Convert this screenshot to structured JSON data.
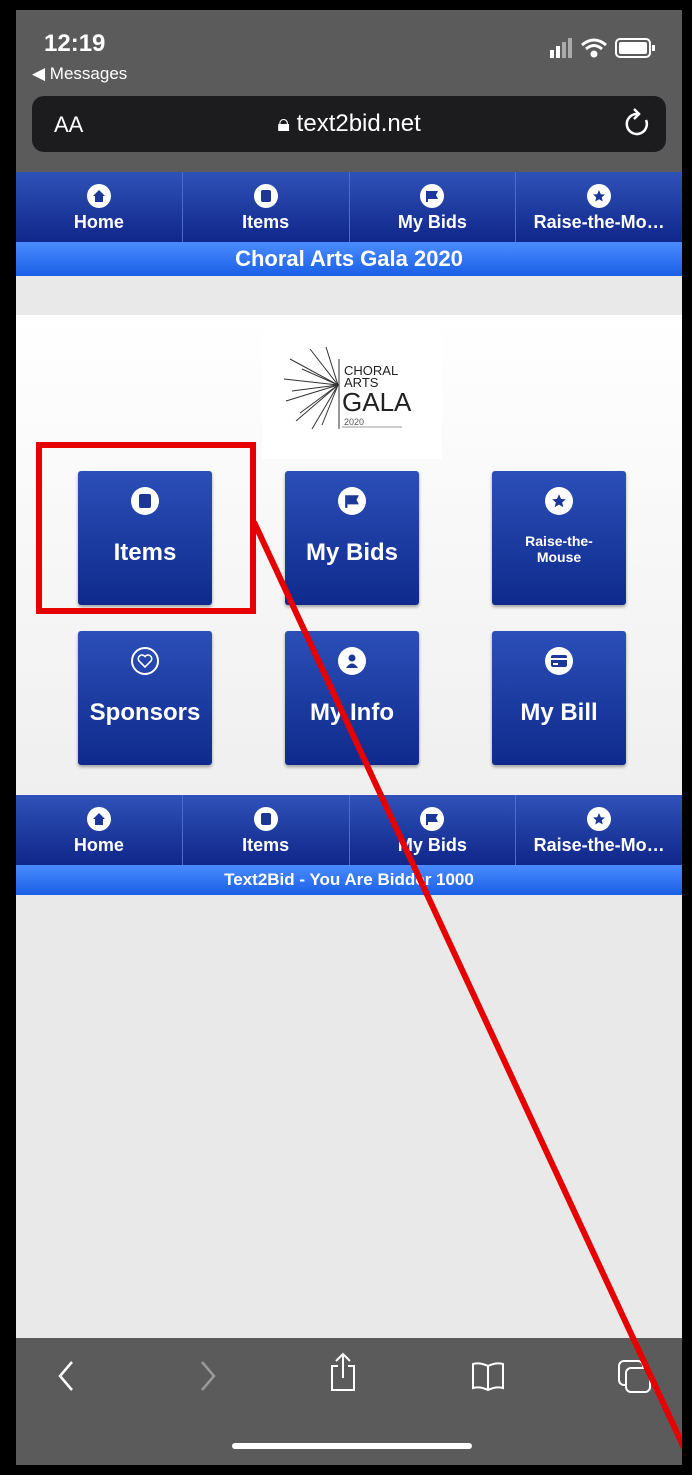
{
  "status": {
    "time": "12:19",
    "back_app": "◀ Messages"
  },
  "browser": {
    "aa": "AA",
    "url": "text2bid.net"
  },
  "nav": [
    {
      "label": "Home",
      "icon": "home-icon"
    },
    {
      "label": "Items",
      "icon": "document-icon"
    },
    {
      "label": "My Bids",
      "icon": "flag-icon"
    },
    {
      "label": "Raise-the-Mo…",
      "icon": "star-icon"
    }
  ],
  "event_title": "Choral Arts Gala 2020",
  "logo": {
    "line1": "CHORAL",
    "line2": "ARTS",
    "line3": "GALA",
    "year": "2020"
  },
  "tiles": [
    {
      "label": "Items",
      "icon": "document-icon"
    },
    {
      "label": "My Bids",
      "icon": "flag-icon"
    },
    {
      "label": "Raise-the-Mouse",
      "icon": "star-icon"
    },
    {
      "label": "Sponsors",
      "icon": "heart-icon"
    },
    {
      "label": "My Info",
      "icon": "person-icon"
    },
    {
      "label": "My Bill",
      "icon": "credit-card-icon"
    }
  ],
  "footer_band": "Text2Bid - You Are Bidder 1000",
  "annotation_color": "#e60000"
}
